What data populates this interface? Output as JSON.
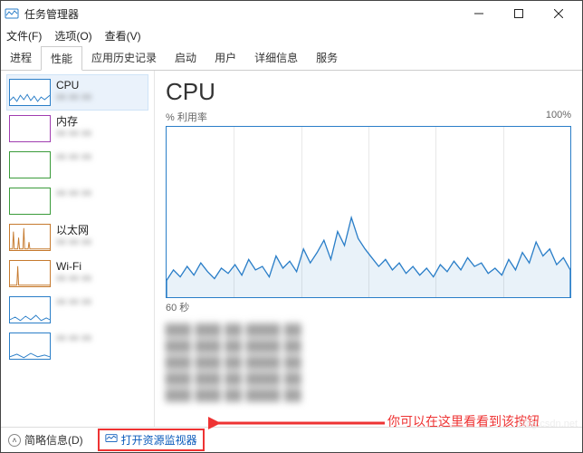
{
  "app": {
    "title": "任务管理器"
  },
  "menu": {
    "file": "文件(F)",
    "options": "选项(O)",
    "view": "查看(V)"
  },
  "tabs": {
    "processes": "进程",
    "performance": "性能",
    "app_history": "应用历史记录",
    "startup": "启动",
    "users": "用户",
    "details": "详细信息",
    "services": "服务"
  },
  "sidebar": {
    "items": [
      {
        "label": "CPU"
      },
      {
        "label": "内存"
      },
      {
        "label": ""
      },
      {
        "label": ""
      },
      {
        "label": "以太网"
      },
      {
        "label": "Wi-Fi"
      },
      {
        "label": ""
      },
      {
        "label": ""
      }
    ]
  },
  "main": {
    "title": "CPU",
    "axis_left": "% 利用率",
    "axis_right": "100%",
    "axis_bottom": "60 秒"
  },
  "statusbar": {
    "fewer_details": "简略信息(D)",
    "open_resmon": "打开资源监视器"
  },
  "annotation": {
    "text": "你可以在这里看看到该按钮"
  },
  "chart_data": {
    "type": "line",
    "title": "CPU",
    "xlabel": "60 秒",
    "ylabel": "% 利用率",
    "ylim": [
      0,
      100
    ],
    "x": [
      0,
      1,
      2,
      3,
      4,
      5,
      6,
      7,
      8,
      9,
      10,
      11,
      12,
      13,
      14,
      15,
      16,
      17,
      18,
      19,
      20,
      21,
      22,
      23,
      24,
      25,
      26,
      27,
      28,
      29,
      30,
      31,
      32,
      33,
      34,
      35,
      36,
      37,
      38,
      39,
      40,
      41,
      42,
      43,
      44,
      45,
      46,
      47,
      48,
      49,
      50,
      51,
      52,
      53,
      54,
      55,
      56,
      57,
      58,
      59
    ],
    "values": [
      12,
      18,
      14,
      20,
      15,
      22,
      17,
      13,
      19,
      16,
      21,
      15,
      24,
      18,
      20,
      14,
      26,
      19,
      23,
      17,
      30,
      22,
      28,
      35,
      24,
      40,
      32,
      48,
      36,
      30,
      25,
      20,
      24,
      18,
      22,
      16,
      20,
      15,
      19,
      14,
      21,
      17,
      23,
      18,
      25,
      20,
      22,
      16,
      19,
      15,
      24,
      18,
      28,
      22,
      34,
      26,
      30,
      21,
      25,
      18
    ]
  }
}
